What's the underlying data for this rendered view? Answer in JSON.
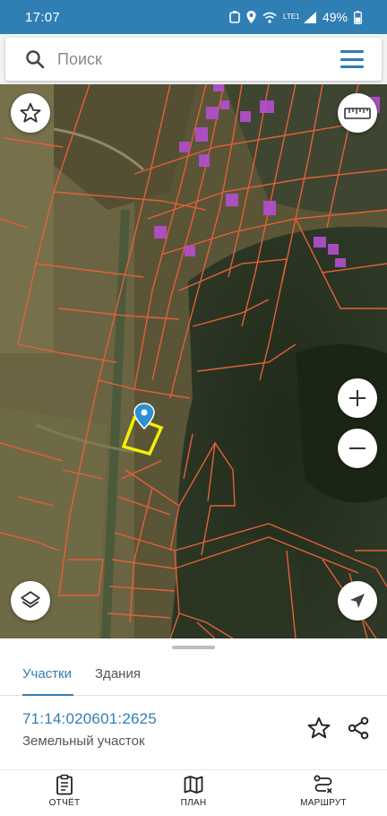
{
  "status_bar": {
    "time": "17:07",
    "network": "LTE1",
    "battery": "49%"
  },
  "search": {
    "placeholder": "Поиск"
  },
  "map": {
    "boundary_color": "#e4603a",
    "building_color": "#b44fd0",
    "selected_parcel_color": "#f3f000",
    "pin_color": "#2b8fd1",
    "controls": [
      "favorites-star-icon",
      "ruler-icon",
      "zoom-in-icon",
      "zoom-out-icon",
      "layers-icon",
      "locate-arrow-icon"
    ]
  },
  "sheet": {
    "tabs": [
      {
        "label": "Участки",
        "active": true
      },
      {
        "label": "Здания",
        "active": false
      }
    ],
    "parcel_id": "71:14:020601:2625",
    "parcel_type": "Земельный участок"
  },
  "bottom_nav": [
    {
      "label": "ОТЧЁТ",
      "icon": "report-icon"
    },
    {
      "label": "ПЛАН",
      "icon": "map-plan-icon"
    },
    {
      "label": "МАРШРУТ",
      "icon": "route-icon"
    }
  ],
  "colors": {
    "accent": "#2f7fb5"
  }
}
